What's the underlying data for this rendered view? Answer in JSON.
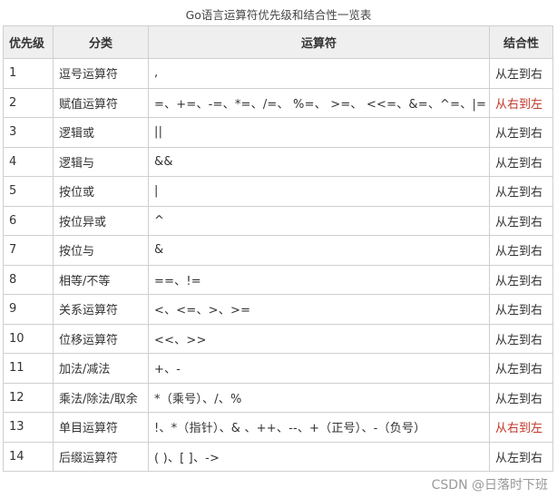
{
  "caption": "Go语言运算符优先级和结合性一览表",
  "headers": {
    "level": "优先级",
    "category": "分类",
    "operators": "运算符",
    "associativity": "结合性"
  },
  "rows": [
    {
      "level": "1",
      "category": "逗号运算符",
      "operators": ",",
      "associativity": "从左到右",
      "rtl": false
    },
    {
      "level": "2",
      "category": "赋值运算符",
      "operators": "=、+=、-=、*=、/=、 %=、 >=、 <<=、&=、^=、|=",
      "associativity": "从右到左",
      "rtl": true
    },
    {
      "level": "3",
      "category": "逻辑或",
      "operators": "||",
      "associativity": "从左到右",
      "rtl": false
    },
    {
      "level": "4",
      "category": "逻辑与",
      "operators": "&&",
      "associativity": "从左到右",
      "rtl": false
    },
    {
      "level": "5",
      "category": "按位或",
      "operators": "|",
      "associativity": "从左到右",
      "rtl": false
    },
    {
      "level": "6",
      "category": "按位异或",
      "operators": "^",
      "associativity": "从左到右",
      "rtl": false
    },
    {
      "level": "7",
      "category": "按位与",
      "operators": "&",
      "associativity": "从左到右",
      "rtl": false
    },
    {
      "level": "8",
      "category": "相等/不等",
      "operators": "==、!=",
      "associativity": "从左到右",
      "rtl": false
    },
    {
      "level": "9",
      "category": "关系运算符",
      "operators": "<、<=、>、>=",
      "associativity": "从左到右",
      "rtl": false
    },
    {
      "level": "10",
      "category": "位移运算符",
      "operators": "<<、>>",
      "associativity": "从左到右",
      "rtl": false
    },
    {
      "level": "11",
      "category": "加法/减法",
      "operators": "+、-",
      "associativity": "从左到右",
      "rtl": false
    },
    {
      "level": "12",
      "category": "乘法/除法/取余",
      "operators": "*（乘号）、/、%",
      "associativity": "从左到右",
      "rtl": false
    },
    {
      "level": "13",
      "category": "单目运算符",
      "operators": "!、*（指针）、& 、++、--、+（正号）、-（负号）",
      "associativity": "从右到左",
      "rtl": true
    },
    {
      "level": "14",
      "category": "后缀运算符",
      "operators": "( )、[ ]、->",
      "associativity": "从左到右",
      "rtl": false
    }
  ],
  "watermark": "CSDN @日落时下班",
  "colors": {
    "header_bg": "#efefef",
    "border": "#cfcfcf",
    "rtl_text": "#c0392b",
    "text": "#333333"
  }
}
